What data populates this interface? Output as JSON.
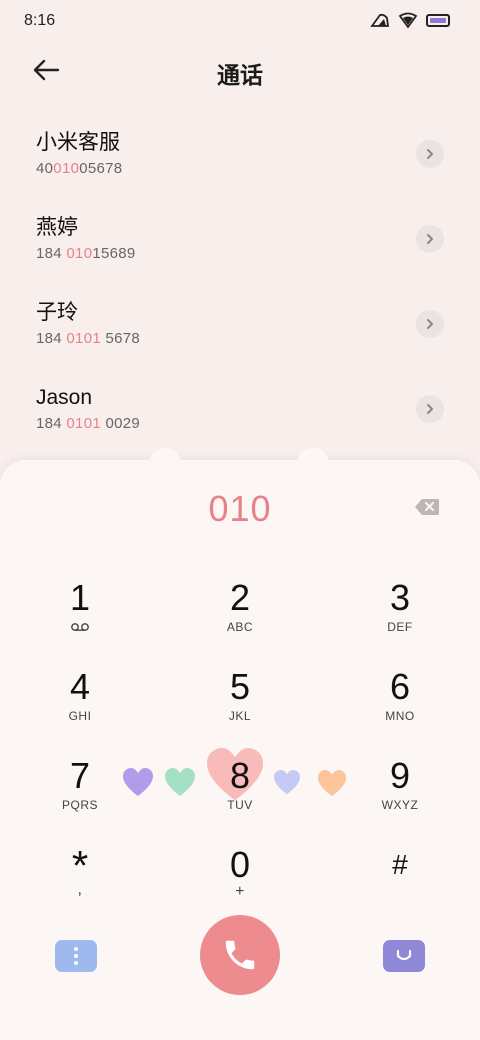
{
  "status_bar": {
    "time": "8:16"
  },
  "header": {
    "title": "通话"
  },
  "contacts": [
    {
      "name": "小米客服",
      "num_pre": "40",
      "num_hl": "010",
      "num_post": "05678"
    },
    {
      "name": "燕婷",
      "num_pre": "184 ",
      "num_hl": "010",
      "num_post": "15689"
    },
    {
      "name": "子玲",
      "num_pre": "184 ",
      "num_hl": "0101",
      "num_post": " 5678"
    },
    {
      "name": "Jason",
      "num_pre": "184 ",
      "num_hl": "0101",
      "num_post": " 0029"
    }
  ],
  "dialer": {
    "input": "010",
    "keys": [
      {
        "digit": "1",
        "letters": ""
      },
      {
        "digit": "2",
        "letters": "ABC"
      },
      {
        "digit": "3",
        "letters": "DEF"
      },
      {
        "digit": "4",
        "letters": "GHI"
      },
      {
        "digit": "5",
        "letters": "JKL"
      },
      {
        "digit": "6",
        "letters": "MNO"
      },
      {
        "digit": "7",
        "letters": "PQRS"
      },
      {
        "digit": "8",
        "letters": "TUV"
      },
      {
        "digit": "9",
        "letters": "WXYZ"
      },
      {
        "digit": "*",
        "letters": ","
      },
      {
        "digit": "0",
        "letters": "+"
      },
      {
        "digit": "#",
        "letters": ""
      }
    ]
  },
  "colors": {
    "accent": "#e8828a",
    "call": "#ee8b8e",
    "menu": "#9fb8ee",
    "face": "#8e88d6"
  },
  "icons": {
    "back": "arrow-left-icon",
    "chevron": "chevron-right-icon",
    "delete": "backspace-icon",
    "voicemail": "voicemail-icon",
    "call": "phone-icon",
    "menu": "more-vertical-icon",
    "face": "smile-face-icon"
  }
}
